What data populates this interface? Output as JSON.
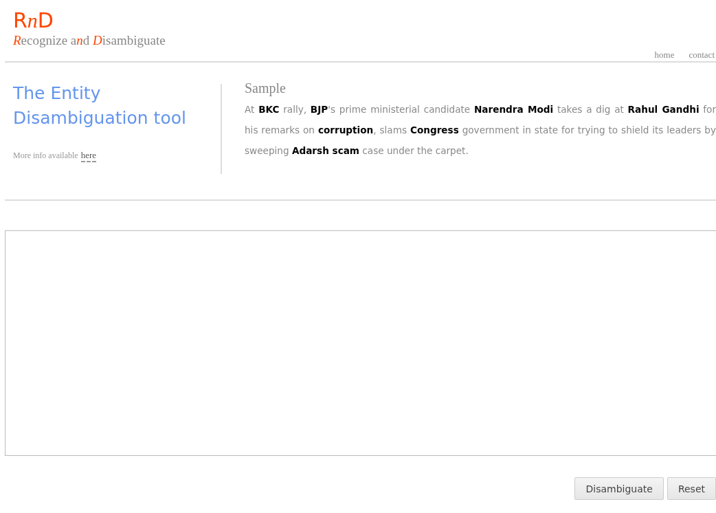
{
  "logo": [
    {
      "text": "R",
      "italic": false
    },
    {
      "text": "n",
      "italic": true
    },
    {
      "text": "D",
      "italic": false
    }
  ],
  "tagline": [
    {
      "text": "R",
      "accent": true
    },
    {
      "text": "ecognize a",
      "accent": false
    },
    {
      "text": "n",
      "accent": true
    },
    {
      "text": "d ",
      "accent": false
    },
    {
      "text": "D",
      "accent": true
    },
    {
      "text": "isambiguate",
      "accent": false
    }
  ],
  "nav": [
    "home",
    "contact"
  ],
  "title": "The Entity Disambiguation tool",
  "info": {
    "text": "More info available",
    "link": "here"
  },
  "sample": {
    "heading": "Sample",
    "text": "At **BKC** rally, **BJP**'s prime ministerial candidate **Narendra Modi** takes a dig at **Rahul Gandhi** for his remarks on **corruption**, slams **Congress** government in state for trying to shield its leaders by sweeping **Adarsh scam** case under the carpet."
  },
  "buttons": [
    "Disambiguate",
    "Reset"
  ]
}
